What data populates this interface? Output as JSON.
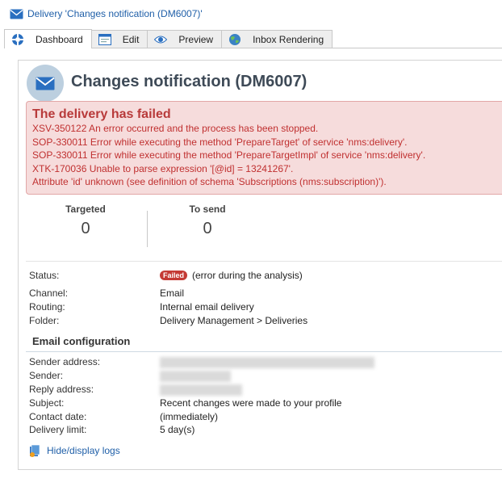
{
  "window": {
    "title": "Delivery 'Changes notification (DM6007)'"
  },
  "tabs": [
    {
      "label": "Dashboard",
      "icon": "dashboard-icon",
      "active": true
    },
    {
      "label": "Edit",
      "icon": "edit-window-icon",
      "active": false
    },
    {
      "label": "Preview",
      "icon": "eye-icon",
      "active": false
    },
    {
      "label": "Inbox Rendering",
      "icon": "globe-icon",
      "active": false
    }
  ],
  "header": {
    "title": "Changes notification (DM6007)",
    "icon": "envelope-icon"
  },
  "error": {
    "title": "The delivery has failed",
    "lines": [
      "XSV-350122 An error occurred and the process has been stopped.",
      "SOP-330011 Error while executing the method 'PrepareTarget' of service 'nms:delivery'.",
      "SOP-330011 Error while executing the method 'PrepareTargetImpl' of service 'nms:delivery'.",
      "XTK-170036 Unable to parse expression '[@id] = 13241267'.",
      "Attribute 'id' unknown (see definition of schema 'Subscriptions (nms:subscription)')."
    ]
  },
  "kpis": [
    {
      "label": "Targeted",
      "value": "0"
    },
    {
      "label": "To send",
      "value": "0"
    }
  ],
  "details": {
    "status_label": "Status:",
    "status_badge": "Failed",
    "status_text": "(error during the analysis)",
    "channel_label": "Channel:",
    "channel_value": "Email",
    "routing_label": "Routing:",
    "routing_value": "Internal email delivery",
    "folder_label": "Folder:",
    "folder_value": "Delivery Management > Deliveries"
  },
  "email_config": {
    "title": "Email configuration",
    "sender_address_label": "Sender address:",
    "sender_label": "Sender:",
    "reply_address_label": "Reply address:",
    "subject_label": "Subject:",
    "subject_value": "Recent changes were made to your profile",
    "contact_date_label": "Contact date:",
    "contact_date_value": "(immediately)",
    "delivery_limit_label": "Delivery limit:",
    "delivery_limit_value": "5 day(s)"
  },
  "logs_link": {
    "label": "Hide/display logs"
  },
  "colors": {
    "link": "#1f5fa8",
    "error_text": "#c03030",
    "error_bg": "#f6dcdc",
    "badge": "#c43a35"
  }
}
